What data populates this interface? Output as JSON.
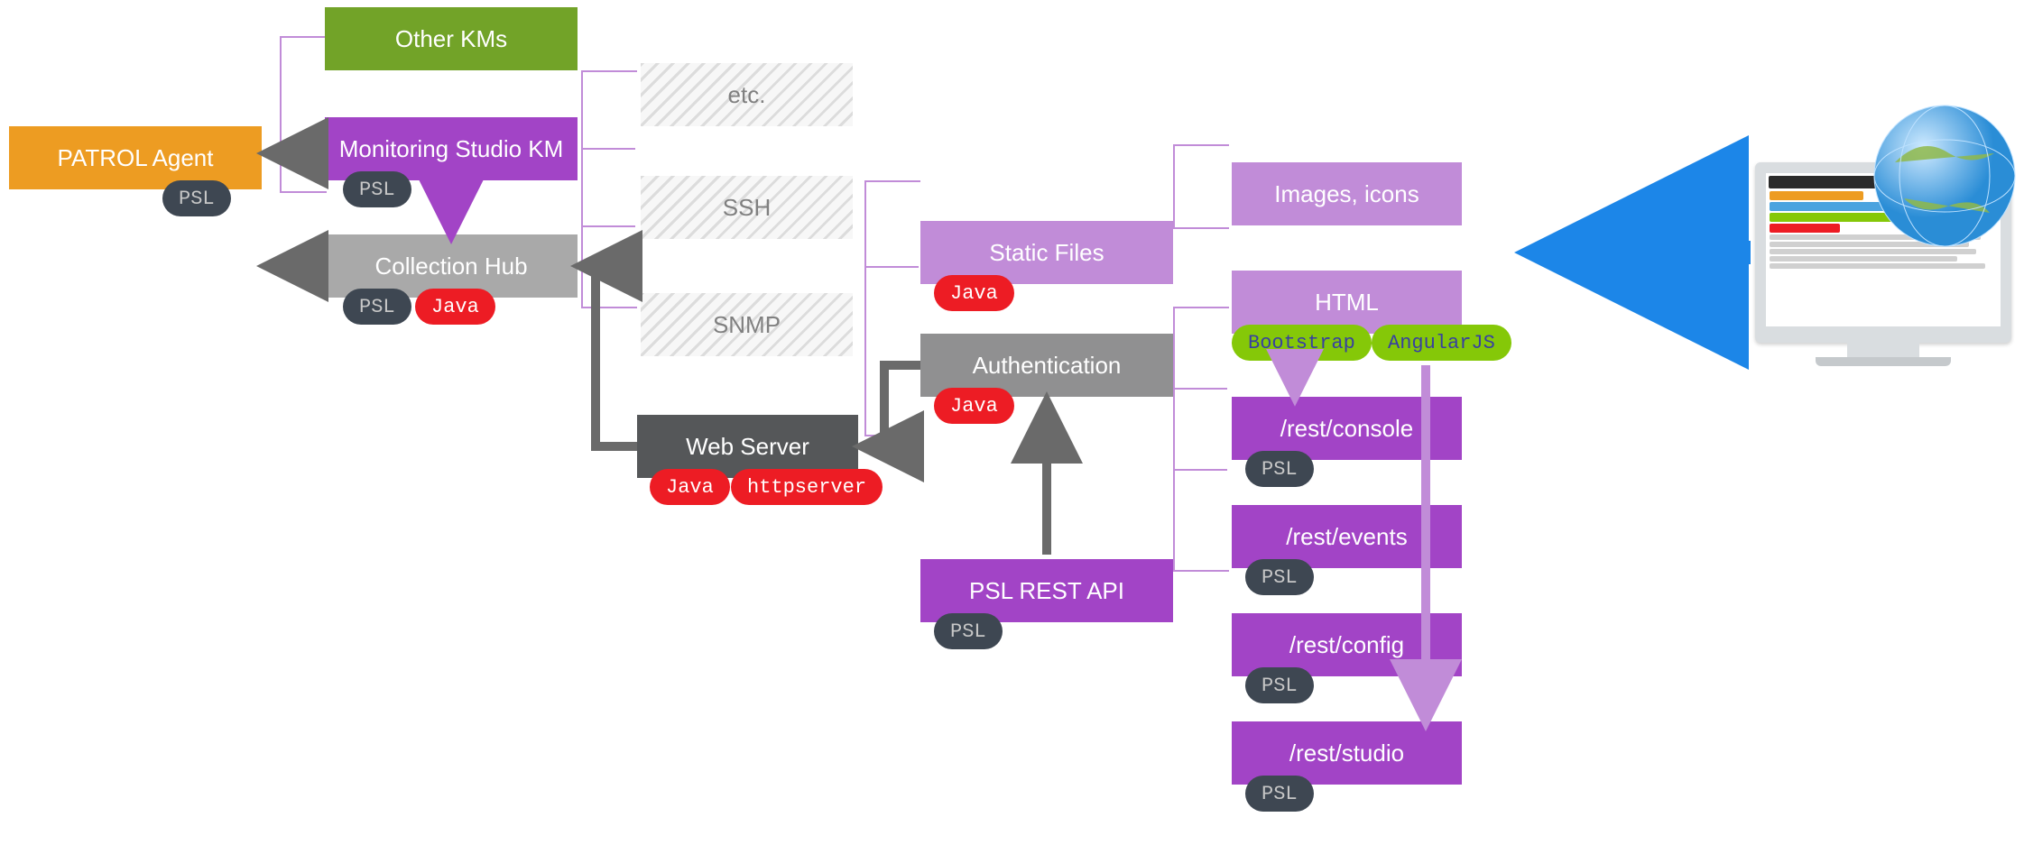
{
  "patrol": "PATROL Agent",
  "otherkm": "Other KMs",
  "mskm": "Monitoring Studio KM",
  "hub": "Collection Hub",
  "proto": {
    "etc": "etc.",
    "ssh": "SSH",
    "snmp": "SNMP"
  },
  "web": "Web Server",
  "static": "Static Files",
  "auth": "Authentication",
  "restapi": "PSL REST API",
  "res": {
    "img": "Images, icons",
    "html": "HTML"
  },
  "endpoints": [
    "/rest/console",
    "/rest/events",
    "/rest/config",
    "/rest/studio"
  ],
  "badge": {
    "psl": "PSL",
    "java": "Java",
    "http": "httpserver",
    "boot": "Bootstrap",
    "ang": "AngularJS"
  }
}
